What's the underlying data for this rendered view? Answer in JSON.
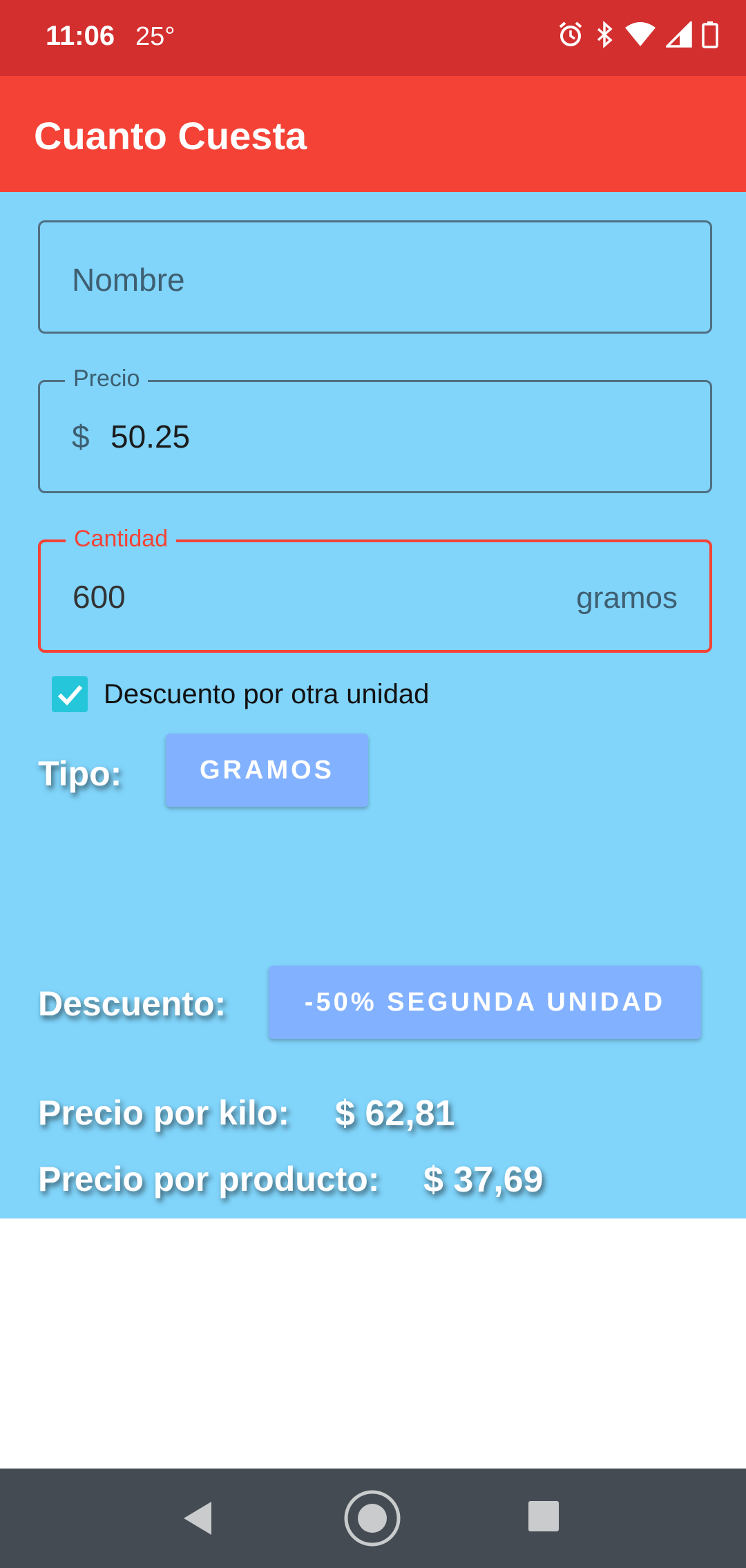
{
  "status_bar": {
    "time": "11:06",
    "temperature": "25°",
    "icons": [
      "alarm-icon",
      "bluetooth-icon",
      "wifi-icon",
      "signal-icon",
      "battery-icon"
    ]
  },
  "app_bar": {
    "title": "Cuanto Cuesta"
  },
  "form": {
    "nombre": {
      "placeholder": "Nombre",
      "value": ""
    },
    "precio": {
      "label": "Precio",
      "prefix": "$",
      "value": "50.25"
    },
    "cantidad": {
      "label": "Cantidad",
      "value": "600",
      "suffix": "gramos"
    }
  },
  "tipo": {
    "label": "Tipo:",
    "button_label": "GRAMOS"
  },
  "descuento_checkbox": {
    "label": "Descuento por otra unidad",
    "checked": true
  },
  "descuento": {
    "label": "Descuento:",
    "button_label": "-50% SEGUNDA UNIDAD"
  },
  "results": {
    "precio_kilo_label": "Precio por kilo:",
    "precio_kilo_value": "$ 62,81",
    "precio_producto_label": "Precio por producto:",
    "precio_producto_value": "$ 37,69"
  },
  "colors": {
    "status_bar": "#d32f2f",
    "app_bar": "#f44336",
    "content_bg": "#81d4fa",
    "button": "#82b1ff",
    "checkbox": "#26c6da",
    "nav_bar": "#444b53"
  },
  "nav": {
    "icons": [
      "back-icon",
      "home-icon",
      "recents-icon"
    ]
  }
}
